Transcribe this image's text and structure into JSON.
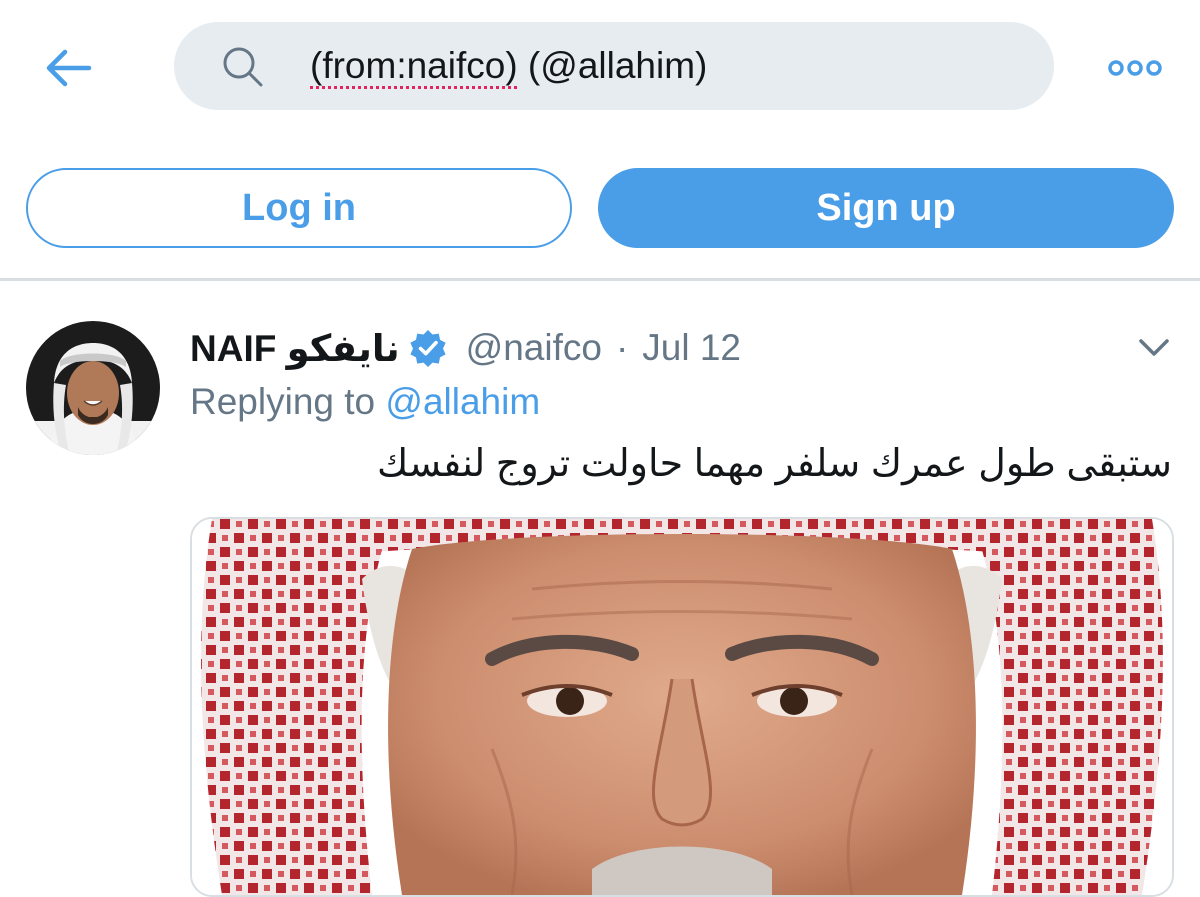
{
  "search": {
    "query_part1": "(from:naifco)",
    "query_part2": " (@allahim)"
  },
  "icons": {
    "back": "back-arrow-icon",
    "search": "search-icon",
    "more": "more-options-icon",
    "verified": "verified-badge-icon",
    "caret": "chevron-down-icon"
  },
  "auth": {
    "login_label": "Log in",
    "signup_label": "Sign up"
  },
  "tweet": {
    "display_name": "NAIF نايفكو",
    "handle": "@naifco",
    "separator": "·",
    "date": "Jul 12",
    "replying_prefix": "Replying to ",
    "replying_to": "@allahim",
    "text": "ستبقى طول عمرك سلفر مهما حاولت تروج لنفسك"
  },
  "colors": {
    "accent": "#4a9ee8",
    "muted_text": "#657786",
    "search_bg": "#e6ecf0"
  }
}
